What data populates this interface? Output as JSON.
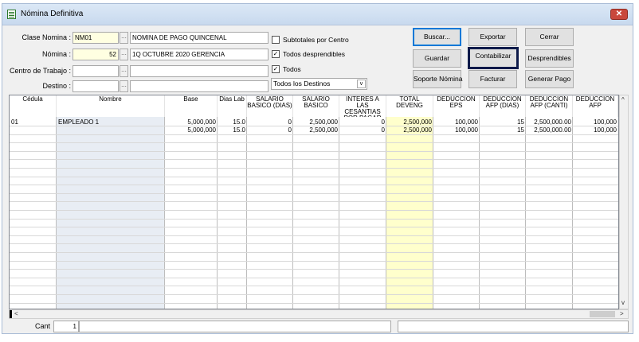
{
  "window": {
    "title": "Nómina Definitiva",
    "close_label": "✕"
  },
  "form": {
    "clase_nomina_label": "Clase Nomina :",
    "clase_nomina_value": "NM01",
    "clase_nomina_desc": "NOMINA DE PAGO QUINCENAL",
    "nomina_label": "Nómina :",
    "nomina_value": "52",
    "nomina_desc": "1Q OCTUBRE 2020 GERENCIA",
    "centro_label": "Centro de Trabajo :",
    "centro_value": "",
    "centro_desc": "",
    "destino_label": "Destino :",
    "destino_value": "",
    "destino_desc": "",
    "lookup_glyph": "..."
  },
  "options": {
    "subtotales_label": "Subtotales por Centro",
    "subtotales_checked": false,
    "desprendibles_label": "Todos desprendibles",
    "desprendibles_checked": true,
    "todos_label": "Todos",
    "todos_checked": true,
    "destinos_select": "Todos los Destinos",
    "check_glyph": "✓",
    "dropdown_glyph": "v"
  },
  "buttons": {
    "buscar": "Buscar...",
    "exportar": "Exportar",
    "cerrar": "Cerrar",
    "guardar": "Guardar",
    "contabilizar": "Contabilizar",
    "desprendibles": "Desprendibles",
    "soporte": "Soporte Nómina",
    "facturar": "Facturar",
    "generar_pago": "Generar Pago"
  },
  "grid": {
    "headers": [
      "Cédula",
      "Nombre",
      "Base",
      "Dias Lab",
      "SALARIO BASICO (DIAS)",
      "SALARIO BASICO",
      "INTERES A LAS CESANTIAS POR PAGAR",
      "TOTAL DEVENG",
      "DEDUCCION EPS",
      "DEDUCCION AFP (DIAS)",
      "DEDUCCION AFP (CANTI)",
      "DEDUCCION AFP"
    ],
    "rows": [
      [
        "01",
        "EMPLEADO 1",
        "5,000,000",
        "15.0",
        "0",
        "2,500,000",
        "0",
        "2,500,000",
        "100,000",
        "15",
        "2,500,000.00",
        "100,000"
      ],
      [
        "",
        "",
        "5,000,000",
        "15.0",
        "0",
        "2,500,000",
        "0",
        "2,500,000",
        "100,000",
        "15",
        "2,500,000.00",
        "100,000"
      ]
    ],
    "highlight_colors": {
      "nombre": "#e8edf4",
      "total_deveng": "#ffffcc"
    }
  },
  "scroll": {
    "up": "^",
    "down": "v",
    "left": "<",
    "right": ">"
  },
  "footer": {
    "cant_label": "Cant",
    "cant_value": "1"
  }
}
